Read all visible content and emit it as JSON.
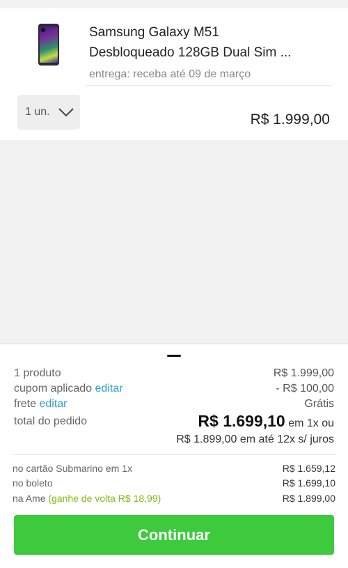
{
  "product": {
    "title_line1": "Samsung Galaxy M51",
    "title_line2": "Desbloqueado 128GB Dual Sim ...",
    "delivery": "entrega: receba até 09 de março",
    "quantity_label": "1 un.",
    "price": "R$ 1.999,00",
    "image_icon": "smartphone-image"
  },
  "summary": {
    "products_label": "1 produto",
    "products_value": "R$ 1.999,00",
    "coupon_label": "cupom aplicado",
    "coupon_edit": "editar",
    "coupon_value": "- R$ 100,00",
    "shipping_label": "frete",
    "shipping_edit": "editar",
    "shipping_value": "Grátis",
    "total_label": "total do pedido",
    "total_value": "R$ 1.699,10",
    "total_suffix": "em 1x ou",
    "installments": "R$ 1.899,00 em até 12x s/ juros"
  },
  "payment_options": {
    "card_label": "no cartão Submarino em 1x",
    "card_value": "R$ 1.659,12",
    "boleto_label": "no boleto",
    "boleto_value": "R$ 1.699,10",
    "ame_label": "na Ame",
    "ame_cashback": "(ganhe de volta R$ 18,99)",
    "ame_value": "R$ 1.899,00"
  },
  "cta": {
    "label": "Continuar"
  },
  "colors": {
    "link": "#2aa4c6",
    "discount": "#86b817",
    "cta": "#3dca3d"
  }
}
